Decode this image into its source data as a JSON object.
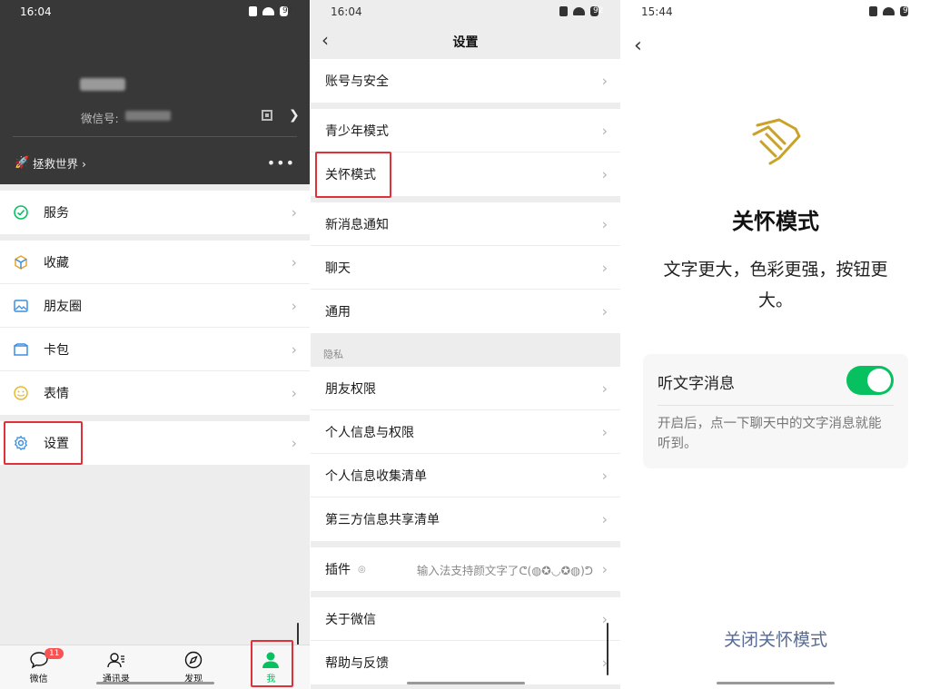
{
  "panel1": {
    "status": {
      "time": "16:04",
      "battery": "92"
    },
    "profile": {
      "wechat_id_label": "微信号:",
      "status_text": "拯救世界 ›"
    },
    "menu": [
      "服务",
      "收藏",
      "朋友圈",
      "卡包",
      "表情",
      "设置"
    ],
    "tabs": [
      {
        "label": "微信",
        "badge": "11"
      },
      {
        "label": "通讯录"
      },
      {
        "label": "发现"
      },
      {
        "label": "我"
      }
    ]
  },
  "panel2": {
    "status": {
      "time": "16:04",
      "battery": "92"
    },
    "title": "设置",
    "groups": [
      [
        "账号与安全"
      ],
      [
        "青少年模式",
        "关怀模式"
      ],
      [
        "新消息通知",
        "聊天",
        "通用"
      ],
      [
        "朋友权限",
        "个人信息与权限",
        "个人信息收集清单",
        "第三方信息共享清单"
      ],
      [
        "插件"
      ],
      [
        "关于微信",
        "帮助与反馈"
      ]
    ],
    "privacy_label": "隐私",
    "plugin_value": "输入法支持颜文字了ᕦ(◍✪◡✪◍)ᕤ"
  },
  "panel3": {
    "status": {
      "time": "15:44",
      "battery": "94"
    },
    "title": "关怀模式",
    "description": "文字更大，色彩更强，按钮更大。",
    "option_label": "听文字消息",
    "option_on": true,
    "option_help": "开启后，点一下聊天中的文字消息就能听到。",
    "close_button": "关闭关怀模式"
  },
  "colors": {
    "accent": "#07c160",
    "link": "#576b95",
    "highlight": "#e0303a",
    "badge": "#fa5151"
  }
}
